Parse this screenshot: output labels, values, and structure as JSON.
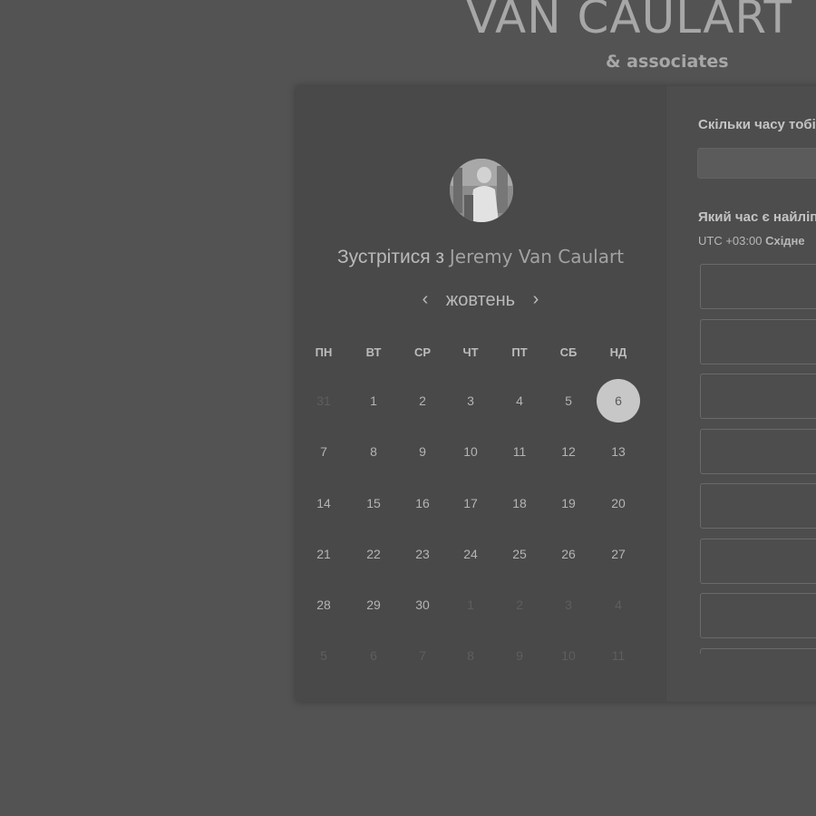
{
  "brand": {
    "name": "VAN CAULART",
    "sub": "& associates"
  },
  "booking": {
    "meet_prefix": "Зустрітися з",
    "host_name": "Jeremy Van Caulart",
    "month": "жовтень",
    "prev_icon": "chevron-left-icon",
    "next_icon": "chevron-right-icon",
    "weekdays": [
      "ПН",
      "ВТ",
      "СР",
      "ЧТ",
      "ПТ",
      "СБ",
      "НД"
    ],
    "weeks": [
      [
        {
          "d": "31",
          "muted": true
        },
        {
          "d": "1"
        },
        {
          "d": "2"
        },
        {
          "d": "3"
        },
        {
          "d": "4"
        },
        {
          "d": "5"
        },
        {
          "d": "6",
          "selected": true
        }
      ],
      [
        {
          "d": "7"
        },
        {
          "d": "8"
        },
        {
          "d": "9"
        },
        {
          "d": "10"
        },
        {
          "d": "11"
        },
        {
          "d": "12"
        },
        {
          "d": "13"
        }
      ],
      [
        {
          "d": "14"
        },
        {
          "d": "15"
        },
        {
          "d": "16"
        },
        {
          "d": "17"
        },
        {
          "d": "18"
        },
        {
          "d": "19"
        },
        {
          "d": "20"
        }
      ],
      [
        {
          "d": "21"
        },
        {
          "d": "22"
        },
        {
          "d": "23"
        },
        {
          "d": "24"
        },
        {
          "d": "25"
        },
        {
          "d": "26"
        },
        {
          "d": "27"
        }
      ],
      [
        {
          "d": "28"
        },
        {
          "d": "29"
        },
        {
          "d": "30"
        },
        {
          "d": "1",
          "muted": true
        },
        {
          "d": "2",
          "muted": true
        },
        {
          "d": "3",
          "muted": true
        },
        {
          "d": "4",
          "muted": true
        }
      ],
      [
        {
          "d": "5",
          "muted": true
        },
        {
          "d": "6",
          "muted": true
        },
        {
          "d": "7",
          "muted": true
        },
        {
          "d": "8",
          "muted": true
        },
        {
          "d": "9",
          "muted": true
        },
        {
          "d": "10",
          "muted": true
        },
        {
          "d": "11",
          "muted": true
        }
      ]
    ]
  },
  "schedule": {
    "duration_question": "Скільки часу тобі",
    "time_question": "Який час є найліп",
    "tz_offset": "UTC +03:00",
    "tz_name": "Східне",
    "slot_count": 8
  },
  "colors": {
    "background": "#535353",
    "card": "#494949",
    "selected_day": "#c7c7c7"
  }
}
